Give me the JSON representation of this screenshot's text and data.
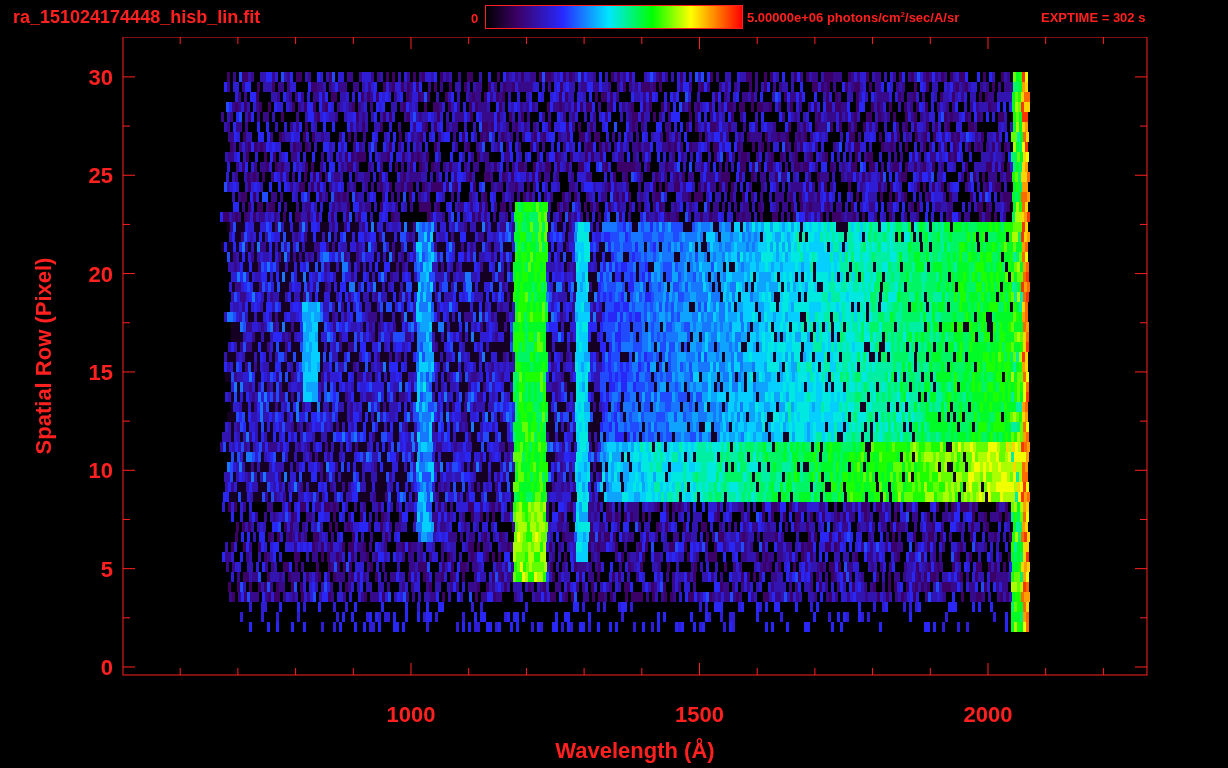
{
  "title": "ra_151024174448_hisb_lin.fit",
  "colorbar": {
    "min_label": "0",
    "max_label": "5.00000e+06 photons/cm$^{2}$/sec/A/sr"
  },
  "exposure": "EXPTIME = 302 s",
  "plot": {
    "xlabel": "Wavelength (Å)",
    "ylabel": "Spatial Row (Pixel)",
    "xtick_labels": [
      "1000",
      "1500",
      "2000"
    ],
    "ytick_labels": [
      "30",
      "25",
      "20",
      "15",
      "10",
      "5",
      "0"
    ]
  }
}
